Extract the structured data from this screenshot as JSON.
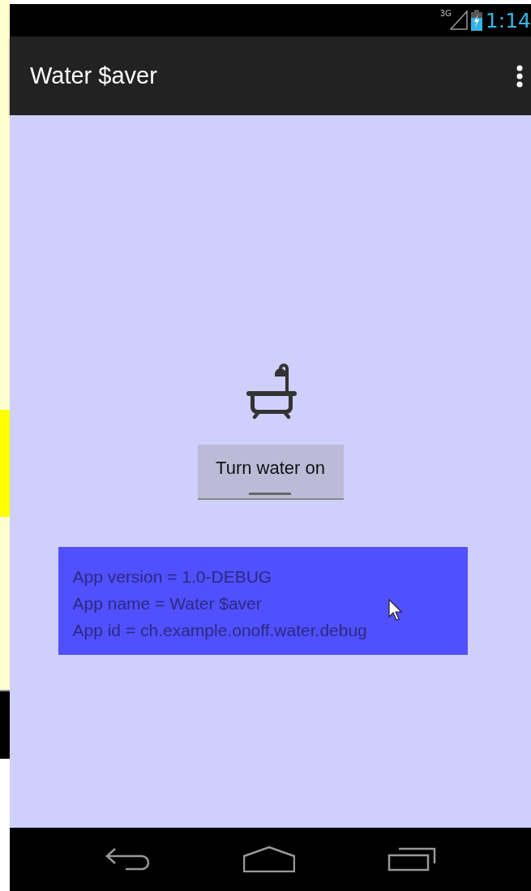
{
  "status_bar": {
    "network": "3G",
    "time": "1:14"
  },
  "app_bar": {
    "title": "Water $aver"
  },
  "content": {
    "button": {
      "label": "Turn water on"
    },
    "info_lines": [
      "App version = 1.0-DEBUG",
      "App name = Water $aver",
      "App id = ch.example.onoff.water.debug"
    ]
  }
}
